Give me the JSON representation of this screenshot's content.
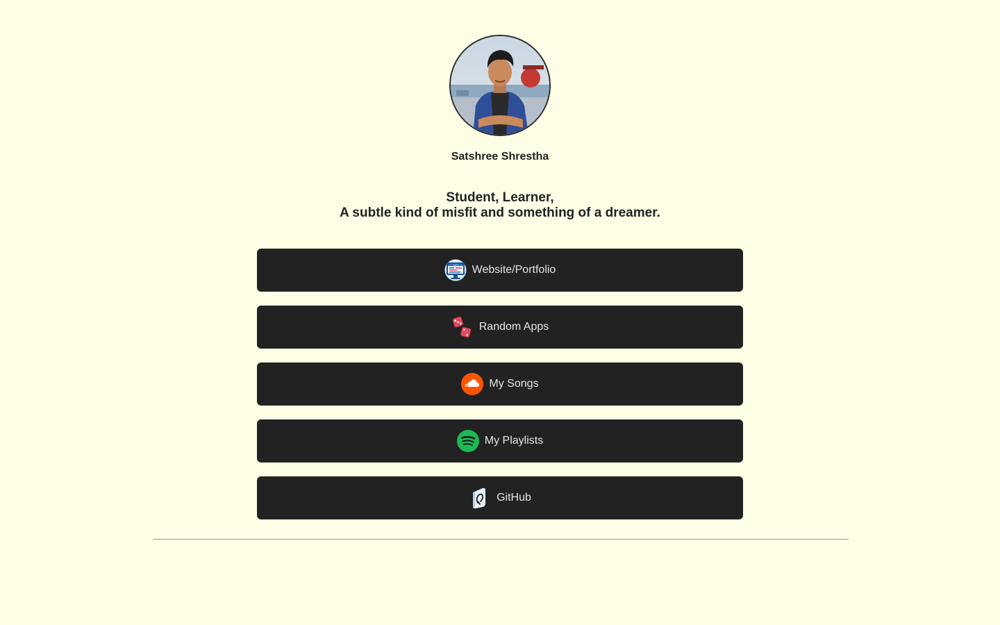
{
  "profile": {
    "name": "Satshree Shrestha",
    "bio_line1": "Student, Learner,",
    "bio_line2": "A subtle kind of misfit and something of a dreamer."
  },
  "links": [
    {
      "label": "Website/Portfolio",
      "icon": "monitor-code-icon"
    },
    {
      "label": "Random Apps",
      "icon": "dice-icon"
    },
    {
      "label": "My Songs",
      "icon": "soundcloud-icon"
    },
    {
      "label": "My Playlists",
      "icon": "spotify-icon"
    },
    {
      "label": "GitHub",
      "icon": "github-icon"
    }
  ],
  "colors": {
    "background": "#fefde6",
    "button": "#222222",
    "button_text": "#e6e6e6",
    "soundcloud": "#ff5500",
    "spotify": "#1db954",
    "dice": "#e8455a"
  }
}
